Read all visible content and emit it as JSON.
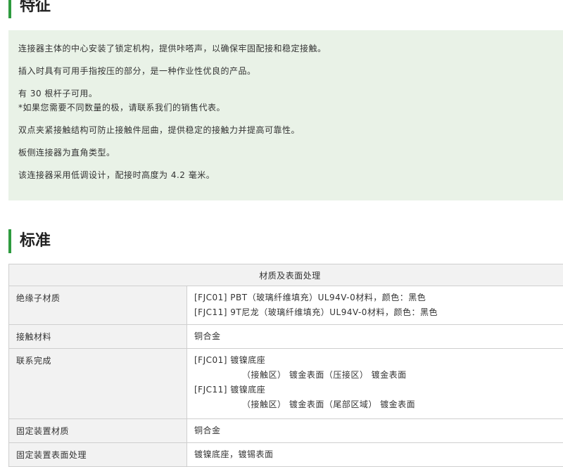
{
  "features": {
    "heading": "特征",
    "items": [
      "连接器主体的中心安装了锁定机构，提供咔嗒声，以确保牢固配接和稳定接触。",
      "插入时具有可用手指按压的部分，是一种作业性优良的产品。",
      "有 30 根杆子可用。",
      "*如果您需要不同数量的极，请联系我们的销售代表。",
      "双点夹紧接触结构可防止接触件屈曲，提供稳定的接触力并提高可靠性。",
      "板侧连接器为直角类型。",
      "该连接器采用低调设计，配接时高度为 4.2 毫米。"
    ]
  },
  "standards": {
    "heading": "标准",
    "table_header": "材质及表面处理",
    "rows": [
      {
        "label": "绝缘子材质",
        "lines": [
          "[FJC01] PBT（玻璃纤维填充）UL94V-0材料，颜色：黑色",
          "[FJC11] 9T尼龙（玻璃纤维填充）UL94V-0材料，颜色：黑色"
        ]
      },
      {
        "label": "接触材料",
        "lines": [
          "铜合金"
        ]
      },
      {
        "label": "联系完成",
        "lines": [
          "[FJC01] 镀镍底座",
          "（接触区） 镀金表面（压接区） 镀金表面",
          "[FJC11] 镀镍底座",
          "（接触区） 镀金表面（尾部区域） 镀金表面"
        ]
      },
      {
        "label": "固定装置材质",
        "lines": [
          "铜合金"
        ]
      },
      {
        "label": "固定装置表面处理",
        "lines": [
          "镀镍底座，镀锡表面"
        ]
      }
    ]
  },
  "colors": {
    "accent": "#2e9b3f",
    "features_background": "#e9f2e7",
    "table_header_background": "#f2f2f2"
  }
}
